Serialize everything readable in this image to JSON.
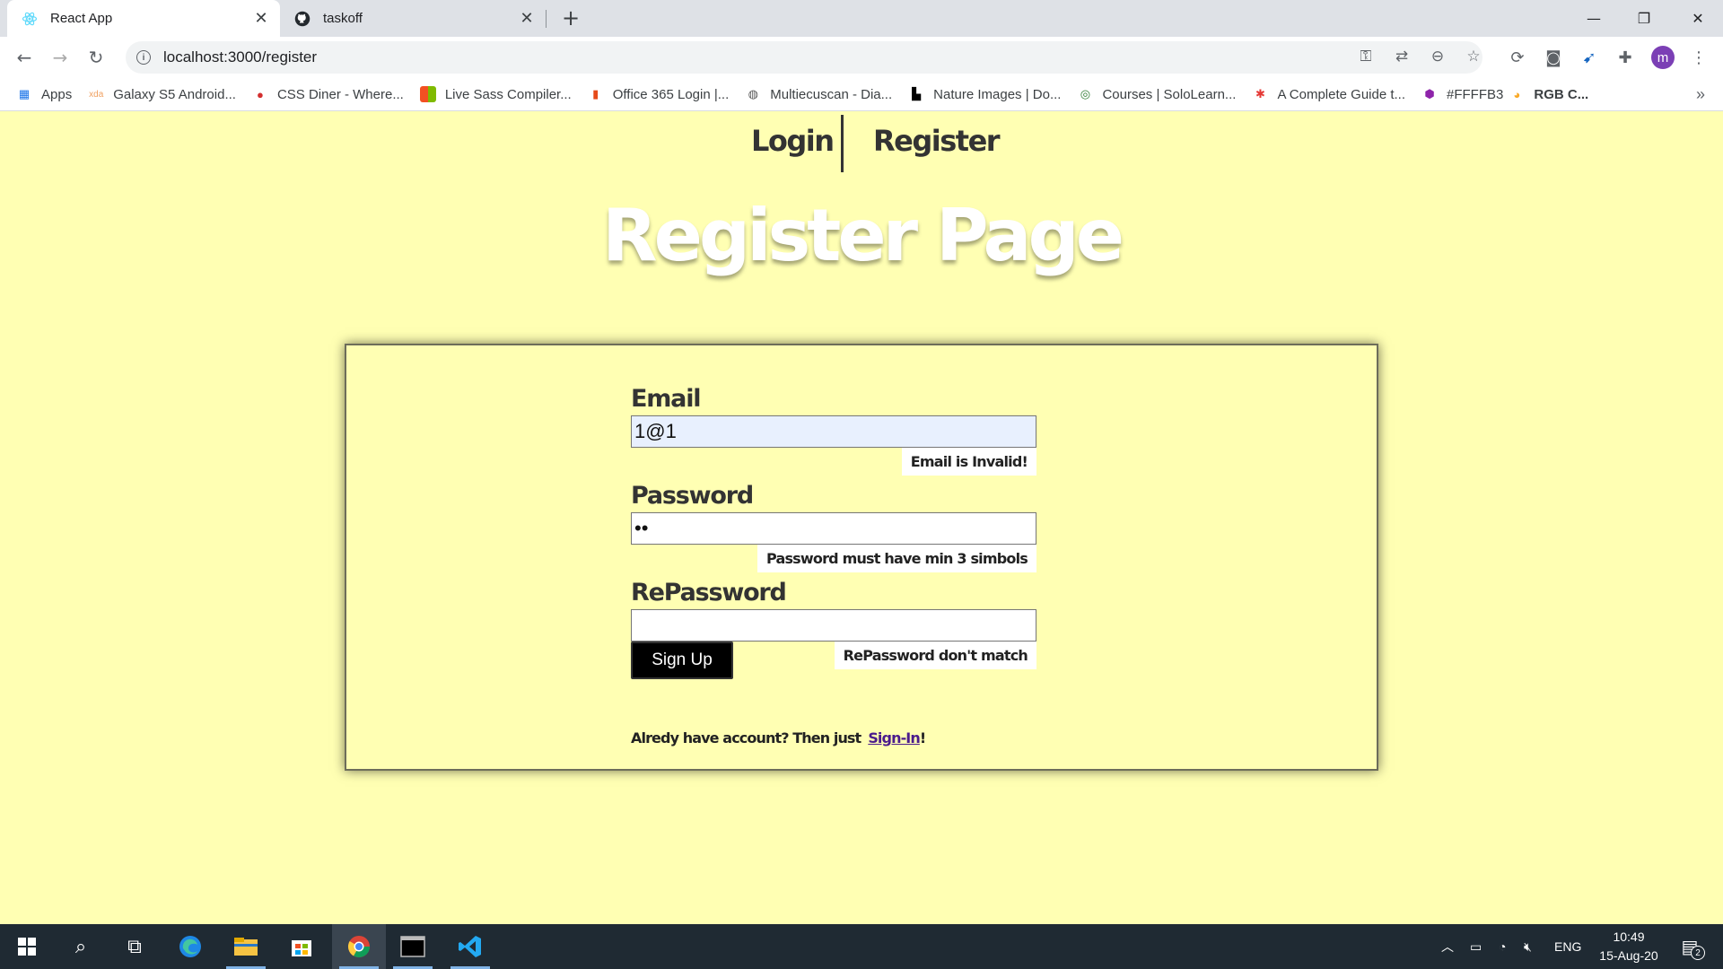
{
  "browser": {
    "tabs": [
      {
        "title": "React App",
        "icon": "react-icon",
        "active": true
      },
      {
        "title": "taskoff",
        "icon": "github-icon",
        "active": false
      }
    ],
    "url": "localhost:3000/register",
    "profile_initial": "m",
    "bookmarks": [
      {
        "label": "Apps",
        "icon": "apps-grid-icon"
      },
      {
        "label": "Galaxy S5 Android...",
        "icon": "xda-icon"
      },
      {
        "label": "CSS Diner - Where...",
        "icon": "css-diner-icon"
      },
      {
        "label": "Live Sass Compiler...",
        "icon": "microsoft-icon"
      },
      {
        "label": "Office 365 Login |...",
        "icon": "office-icon"
      },
      {
        "label": "Multiecuscan - Dia...",
        "icon": "globe-icon"
      },
      {
        "label": "Nature Images | Do...",
        "icon": "unsplash-icon"
      },
      {
        "label": "Courses | SoloLearn...",
        "icon": "sololearn-icon"
      },
      {
        "label": "A Complete Guide t...",
        "icon": "css-tricks-icon"
      },
      {
        "label": "#FFFFB3",
        "icon": "colorhexa-icon"
      },
      {
        "label": "RGB C...",
        "icon": "rgb-icon",
        "bold": true
      }
    ]
  },
  "nav": {
    "login": "Login",
    "register": "Register"
  },
  "page_title": "Register Page",
  "form": {
    "email_label": "Email",
    "email_value": "1@1",
    "email_error": "Email is Invalid!",
    "password_label": "Password",
    "password_value": "••",
    "password_error": "Password must have min 3 simbols",
    "repassword_label": "RePassword",
    "repassword_value": "",
    "repassword_error": "RePassword don't match",
    "submit_label": "Sign Up"
  },
  "footer": {
    "text": "Alredy have account? Then just",
    "link": "Sign-In",
    "suffix": "!"
  },
  "taskbar": {
    "language": "ENG",
    "time": "10:49",
    "date": "15-Aug-20",
    "notifications": "2"
  },
  "colors": {
    "page_background": "#FFFFB3",
    "button": "#000000",
    "link": "#4B1C8C"
  }
}
